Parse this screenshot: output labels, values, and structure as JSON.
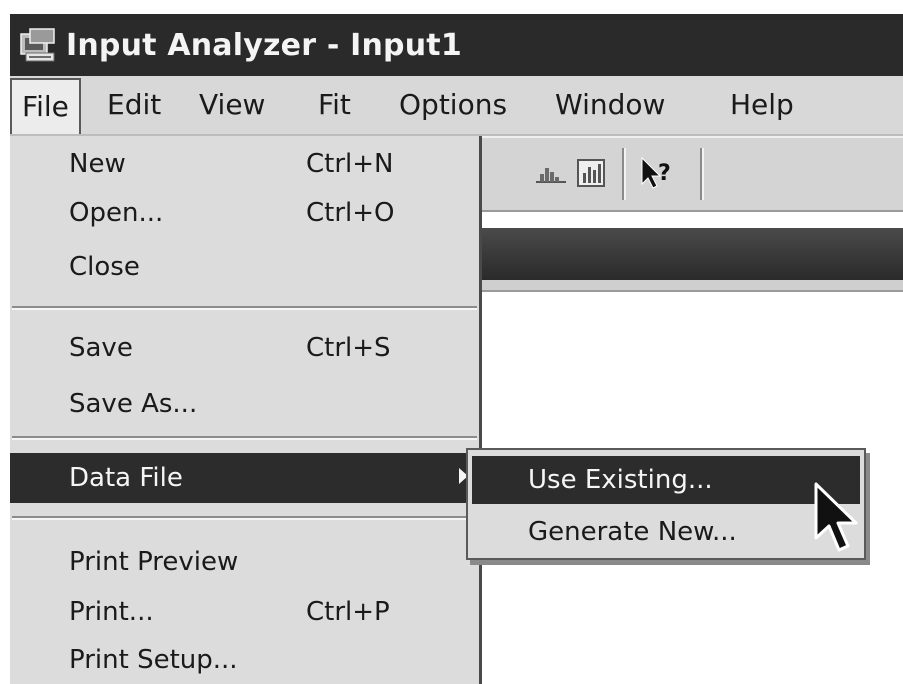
{
  "window": {
    "title": "Input Analyzer - Input1",
    "app_icon": "input-analyzer-app-icon"
  },
  "menubar": {
    "items": [
      {
        "label": "File",
        "active": true
      },
      {
        "label": "Edit"
      },
      {
        "label": "View"
      },
      {
        "label": "Fit"
      },
      {
        "label": "Options"
      },
      {
        "label": "Window"
      },
      {
        "label": "Help"
      }
    ]
  },
  "toolbar": {
    "icons": [
      "histogram-icon",
      "chart-icon",
      "context-help-icon"
    ]
  },
  "file_menu": {
    "items": [
      {
        "label": "New",
        "shortcut": "Ctrl+N"
      },
      {
        "label": "Open...",
        "shortcut": "Ctrl+O"
      },
      {
        "label": "Close",
        "shortcut": ""
      },
      {
        "label": "Save",
        "shortcut": "Ctrl+S"
      },
      {
        "label": "Save As...",
        "shortcut": ""
      },
      {
        "label": "Data File",
        "shortcut": "",
        "highlighted": true,
        "has_submenu": true
      },
      {
        "label": "Print Preview",
        "shortcut": ""
      },
      {
        "label": "Print...",
        "shortcut": "Ctrl+P"
      },
      {
        "label": "Print Setup...",
        "shortcut": ""
      }
    ]
  },
  "data_file_submenu": {
    "items": [
      {
        "label": "Use Existing...",
        "highlighted": true
      },
      {
        "label": "Generate New..."
      }
    ]
  },
  "colors": {
    "titlebar": "#2a2a2a",
    "menu_bg": "#dcdcdc",
    "highlight": "#2c2c2c"
  }
}
